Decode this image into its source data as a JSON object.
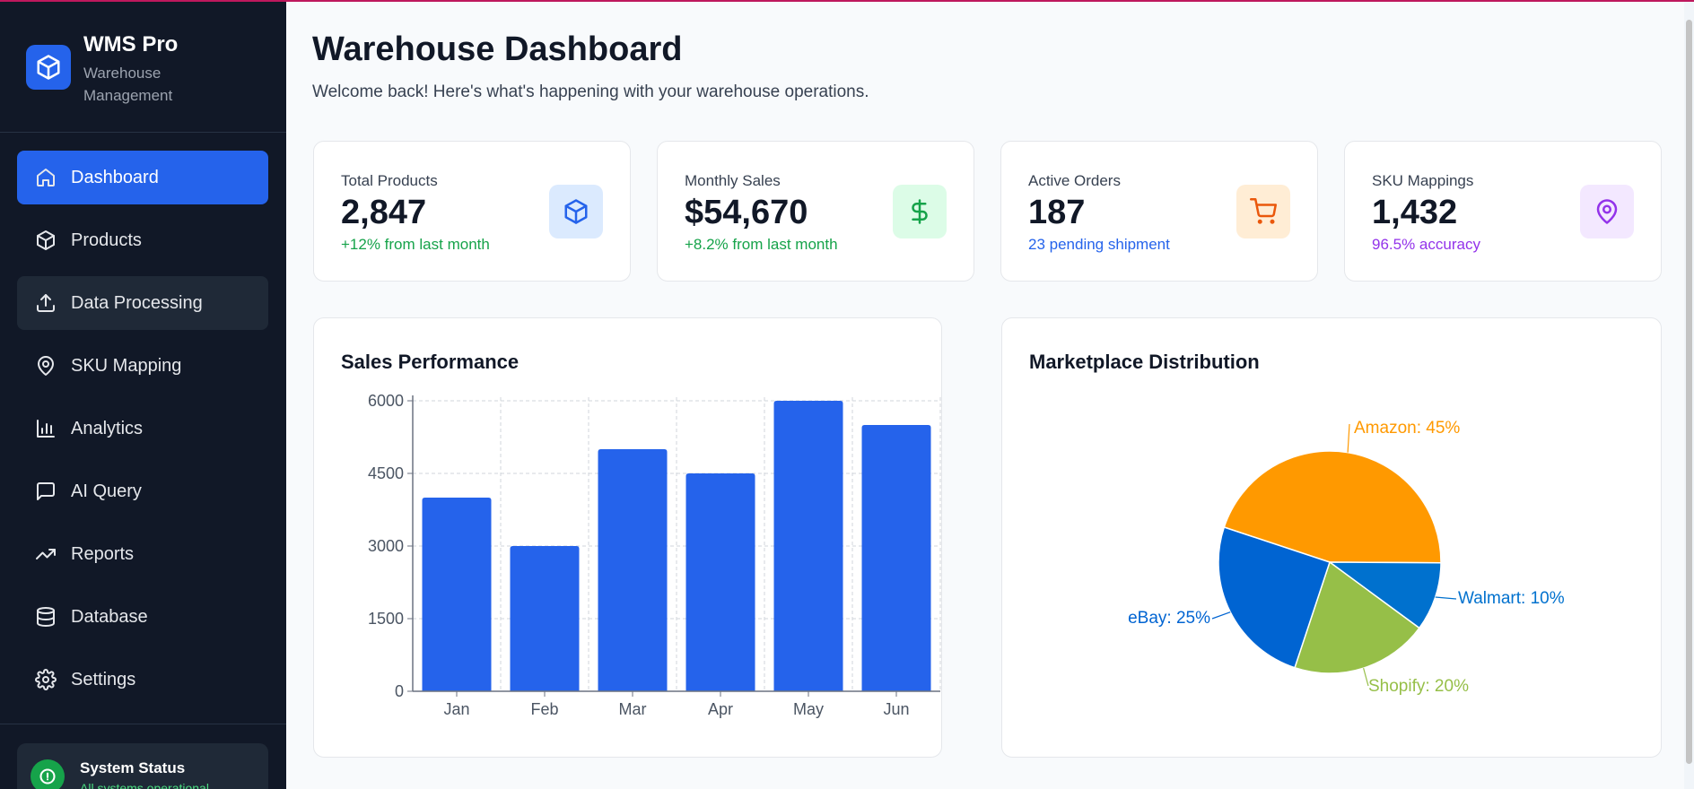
{
  "brand": {
    "title": "WMS Pro",
    "subtitle": "Warehouse Management"
  },
  "nav": [
    {
      "label": "Dashboard",
      "icon": "home-icon",
      "state": "active"
    },
    {
      "label": "Products",
      "icon": "box-icon",
      "state": "normal"
    },
    {
      "label": "Data Processing",
      "icon": "upload-icon",
      "state": "hover"
    },
    {
      "label": "SKU Mapping",
      "icon": "map-pin-icon",
      "state": "normal"
    },
    {
      "label": "Analytics",
      "icon": "bar-chart-icon",
      "state": "normal"
    },
    {
      "label": "AI Query",
      "icon": "message-icon",
      "state": "normal"
    },
    {
      "label": "Reports",
      "icon": "trending-up-icon",
      "state": "normal"
    },
    {
      "label": "Database",
      "icon": "database-icon",
      "state": "normal"
    },
    {
      "label": "Settings",
      "icon": "gear-icon",
      "state": "normal"
    }
  ],
  "system_status": {
    "title": "System Status",
    "subtitle": "All systems operational"
  },
  "header": {
    "title": "Warehouse Dashboard",
    "subtitle": "Welcome back! Here's what's happening with your warehouse operations."
  },
  "stats": [
    {
      "label": "Total Products",
      "value": "2,847",
      "change": "+12% from last month",
      "change_color": "#16a34a",
      "icon": "box-icon",
      "icon_bg": "#dbeafe",
      "icon_color": "#2563eb"
    },
    {
      "label": "Monthly Sales",
      "value": "$54,670",
      "change": "+8.2% from last month",
      "change_color": "#16a34a",
      "icon": "dollar-icon",
      "icon_bg": "#dcfce7",
      "icon_color": "#16a34a"
    },
    {
      "label": "Active Orders",
      "value": "187",
      "change": "23 pending shipment",
      "change_color": "#2563eb",
      "icon": "cart-icon",
      "icon_bg": "#ffedd5",
      "icon_color": "#ea580c"
    },
    {
      "label": "SKU Mappings",
      "value": "1,432",
      "change": "96.5% accuracy",
      "change_color": "#9333ea",
      "icon": "map-pin-icon",
      "icon_bg": "#f3e8ff",
      "icon_color": "#9333ea"
    }
  ],
  "chart_data": [
    {
      "type": "bar",
      "title": "Sales Performance",
      "categories": [
        "Jan",
        "Feb",
        "Mar",
        "Apr",
        "May",
        "Jun"
      ],
      "values": [
        4000,
        3000,
        5000,
        4500,
        6000,
        5500
      ],
      "ylim": [
        0,
        6000
      ],
      "yticks": [
        "0",
        "1500",
        "3000",
        "4500",
        "6000"
      ],
      "color": "#2563eb",
      "grid": true
    },
    {
      "type": "pie",
      "title": "Marketplace Distribution",
      "slices": [
        {
          "label": "Amazon: 45%",
          "value": 45,
          "color": "#ff9900"
        },
        {
          "label": "Walmart: 10%",
          "value": 10,
          "color": "#0071ce"
        },
        {
          "label": "Shopify: 20%",
          "value": 20,
          "color": "#96bf48"
        },
        {
          "label": "eBay: 25%",
          "value": 25,
          "color": "#0064d2"
        }
      ]
    }
  ]
}
